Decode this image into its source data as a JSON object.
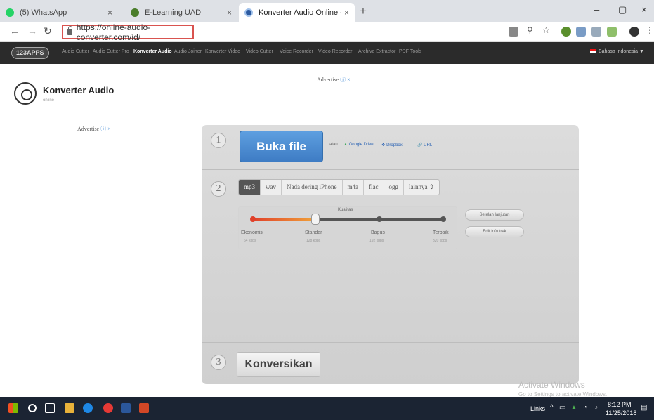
{
  "browser": {
    "tabs": [
      {
        "title": "(5) WhatsApp",
        "color": "#25d366"
      },
      {
        "title": "E-Learning UAD",
        "color": "#4a7d2a"
      },
      {
        "title": "Konverter Audio Online - Konver",
        "color": "#2c5aa0"
      }
    ],
    "close_glyph": "×",
    "new_tab_glyph": "+",
    "url": "https://online-audio-converter.com/id/",
    "window_controls": [
      "–",
      "▢",
      "×"
    ]
  },
  "site_nav": {
    "brand": "123APPS",
    "links": [
      {
        "label": "Audio Cutter",
        "active": false
      },
      {
        "label": "Audio Cutter Pro",
        "active": false
      },
      {
        "label": "Konverter Audio",
        "active": true
      },
      {
        "label": "Audio Joiner",
        "active": false
      },
      {
        "label": "Konverter Video",
        "active": false
      },
      {
        "label": "Video Cutter",
        "active": false
      },
      {
        "label": "Voice Recorder",
        "active": false
      },
      {
        "label": "Video Recorder",
        "active": false
      },
      {
        "label": "Archive Extractor",
        "active": false
      },
      {
        "label": "PDF Tools",
        "active": false
      }
    ],
    "language": "Bahasa Indonesia ▼"
  },
  "header": {
    "title": "Konverter Audio",
    "subtitle": "online"
  },
  "ads": {
    "top_label": "Advertise",
    "left_label": "Advertise",
    "close_glyph": "ⓘ ×"
  },
  "step1": {
    "number": "1",
    "open_button": "Buka file",
    "or_text": "atau",
    "sources": [
      "Google Drive",
      "Dropbox",
      "URL"
    ]
  },
  "step2": {
    "number": "2",
    "formats": [
      {
        "label": "mp3",
        "active": true
      },
      {
        "label": "wav",
        "active": false
      },
      {
        "label": "Nada dering iPhone",
        "active": false
      },
      {
        "label": "m4a",
        "active": false
      },
      {
        "label": "flac",
        "active": false
      },
      {
        "label": "ogg",
        "active": false
      },
      {
        "label": "lainnya  ⇕",
        "active": false
      }
    ],
    "quality_label": "Kualitas",
    "quality_levels": [
      {
        "name": "Ekonomis",
        "rate": "64 kbps"
      },
      {
        "name": "Standar",
        "rate": "128 kbps"
      },
      {
        "name": "Bagus",
        "rate": "192 kbps"
      },
      {
        "name": "Terbaik",
        "rate": "320 kbps"
      }
    ],
    "selected_quality": "Standar",
    "advanced_button": "Setelan lanjutan",
    "edit_info_button": "Edit info trek"
  },
  "step3": {
    "number": "3",
    "convert_button": "Konversikan"
  },
  "watermark": {
    "line1": "Activate Windows",
    "line2": "Go to Settings to activate Windows."
  },
  "taskbar": {
    "links_label": "Links",
    "time": "8:12 PM",
    "date": "11/25/2018"
  },
  "colors": {
    "accent_blue": "#3e7cc4",
    "site_nav_bg": "#2b2b2b",
    "slider_red": "#e0402a",
    "slider_orange": "#f0a23a"
  }
}
